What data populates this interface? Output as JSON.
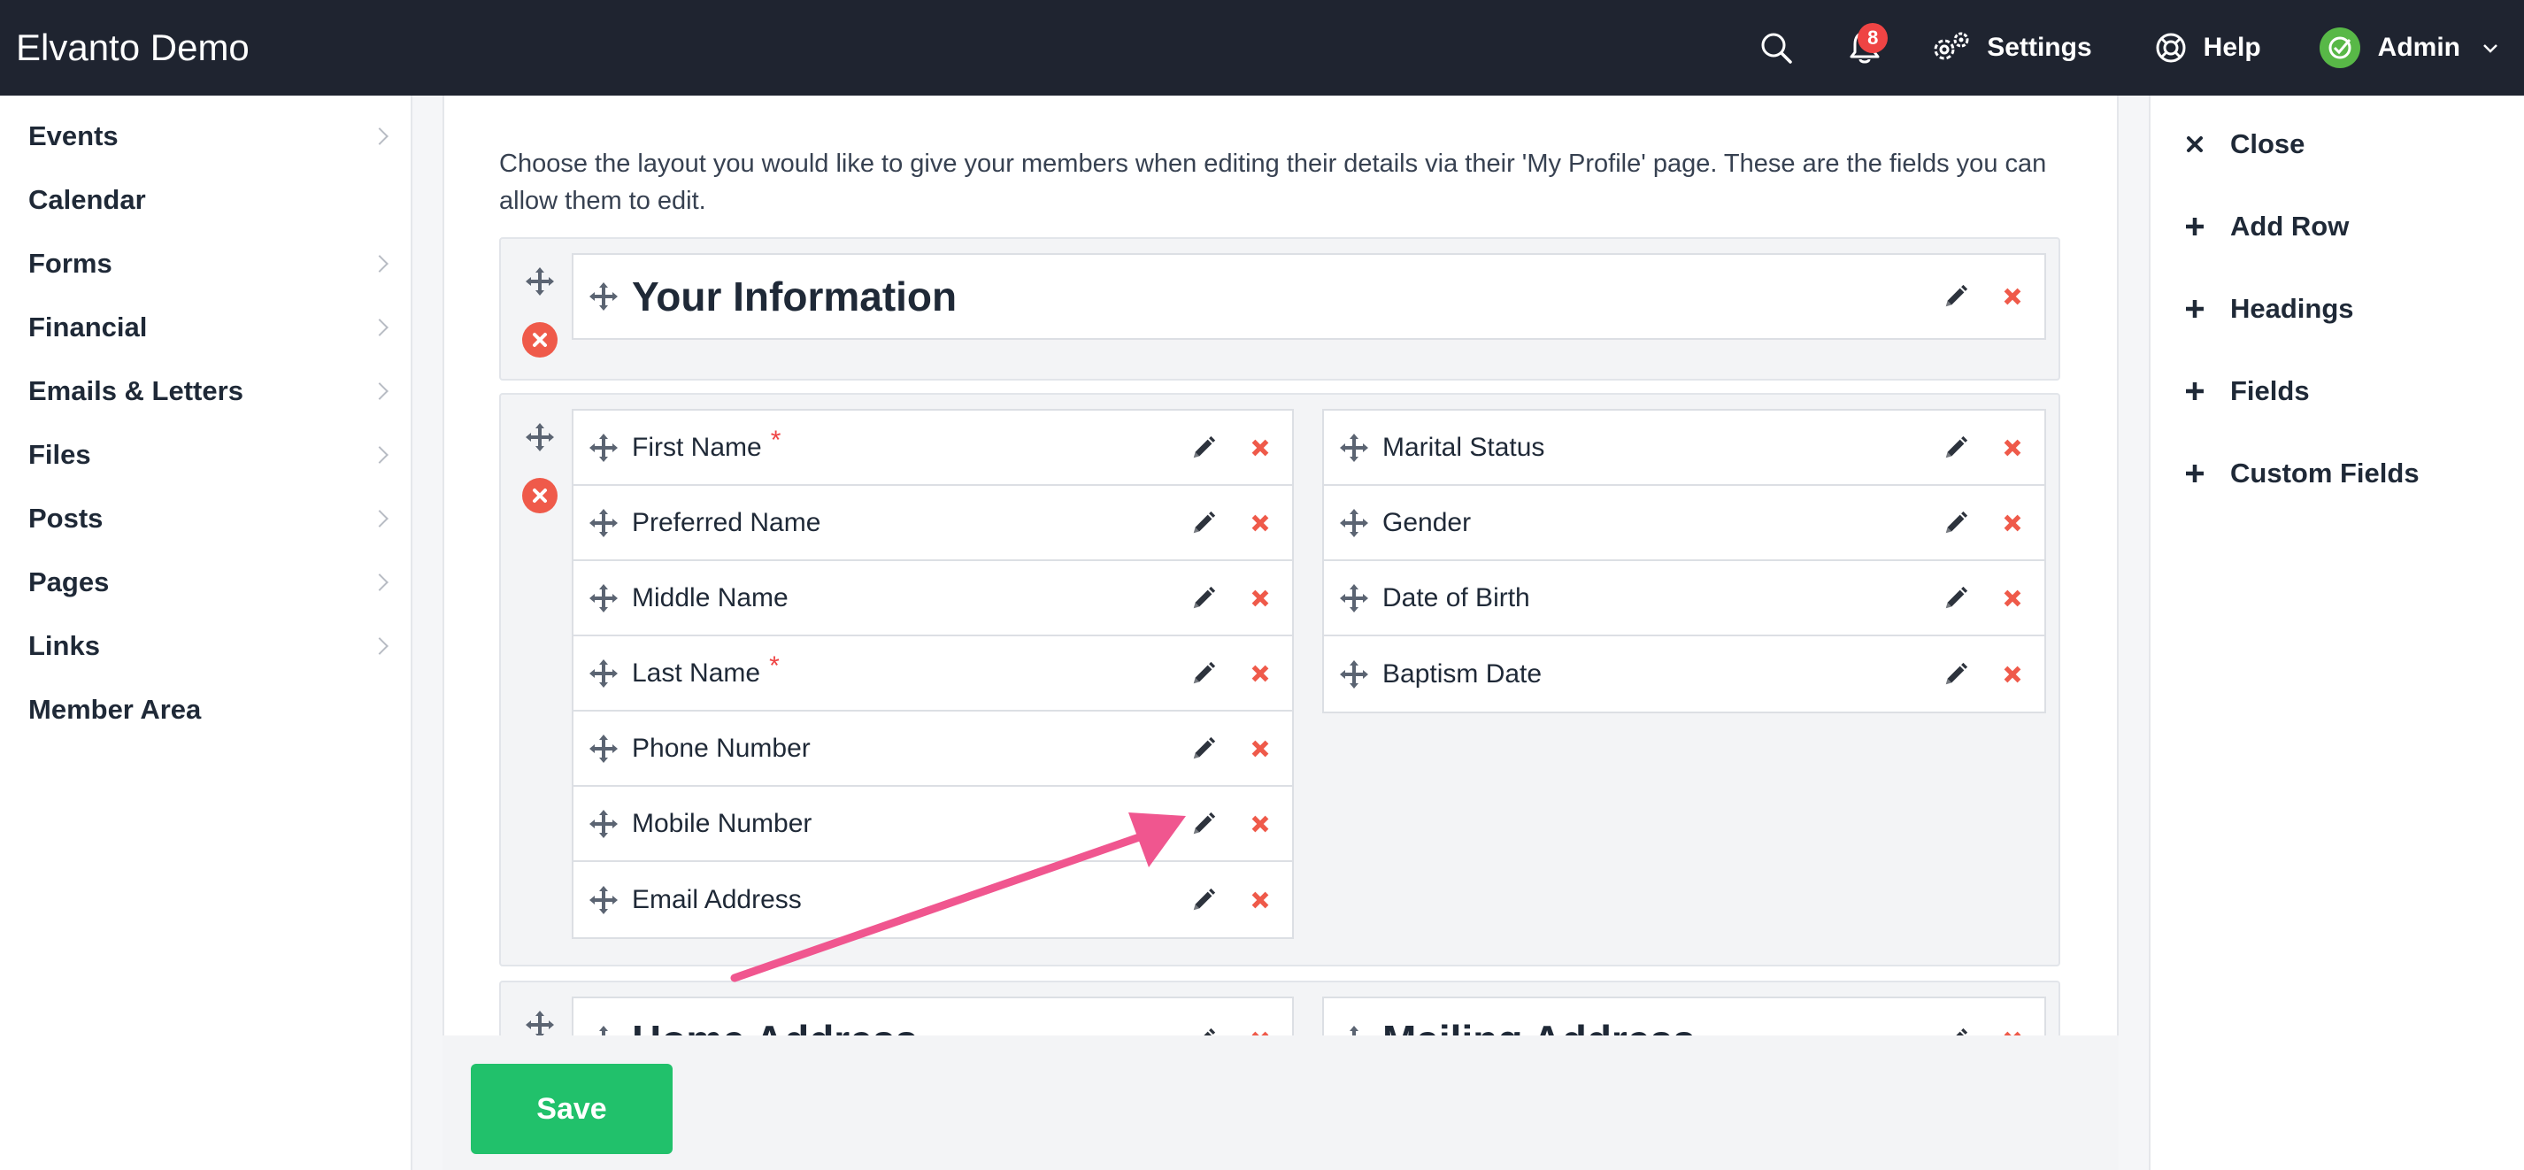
{
  "app": {
    "title": "Elvanto Demo",
    "notifications_count": "8",
    "settings_label": "Settings",
    "help_label": "Help",
    "user_label": "Admin"
  },
  "sidebar": {
    "items": [
      {
        "label": "Events",
        "has_arrow": true
      },
      {
        "label": "Calendar",
        "has_arrow": false
      },
      {
        "label": "Forms",
        "has_arrow": true
      },
      {
        "label": "Financial",
        "has_arrow": true
      },
      {
        "label": "Emails & Letters",
        "has_arrow": true
      },
      {
        "label": "Files",
        "has_arrow": true
      },
      {
        "label": "Posts",
        "has_arrow": true
      },
      {
        "label": "Pages",
        "has_arrow": true
      },
      {
        "label": "Links",
        "has_arrow": true
      },
      {
        "label": "Member Area",
        "has_arrow": false
      }
    ]
  },
  "main": {
    "intro": "Choose the layout you would like to give your members when editing their details via their 'My Profile' page. These are the fields you can allow them to edit.",
    "heading_row": {
      "title": "Your Information"
    },
    "fields_row": {
      "left": [
        {
          "label": "First Name",
          "required": "*"
        },
        {
          "label": "Preferred Name",
          "required": ""
        },
        {
          "label": "Middle Name",
          "required": ""
        },
        {
          "label": "Last Name",
          "required": "*"
        },
        {
          "label": "Phone Number",
          "required": ""
        },
        {
          "label": "Mobile Number",
          "required": ""
        },
        {
          "label": "Email Address",
          "required": ""
        }
      ],
      "right": [
        {
          "label": "Marital Status",
          "required": ""
        },
        {
          "label": "Gender",
          "required": ""
        },
        {
          "label": "Date of Birth",
          "required": ""
        },
        {
          "label": "Baptism Date",
          "required": ""
        }
      ]
    },
    "address_row": {
      "left_title": "Home Address",
      "right_title": "Mailing Address"
    },
    "save_label": "Save"
  },
  "right_panel": {
    "items": [
      {
        "label": "Close",
        "icon": "close-icon"
      },
      {
        "label": "Add Row",
        "icon": "plus-icon"
      },
      {
        "label": "Headings",
        "icon": "plus-icon"
      },
      {
        "label": "Fields",
        "icon": "plus-icon"
      },
      {
        "label": "Custom Fields",
        "icon": "plus-icon"
      }
    ]
  },
  "colors": {
    "topbar": "#1f2430",
    "save": "#21c16b",
    "delete": "#ef5a4a",
    "annotation_arrow": "#f0568f"
  }
}
